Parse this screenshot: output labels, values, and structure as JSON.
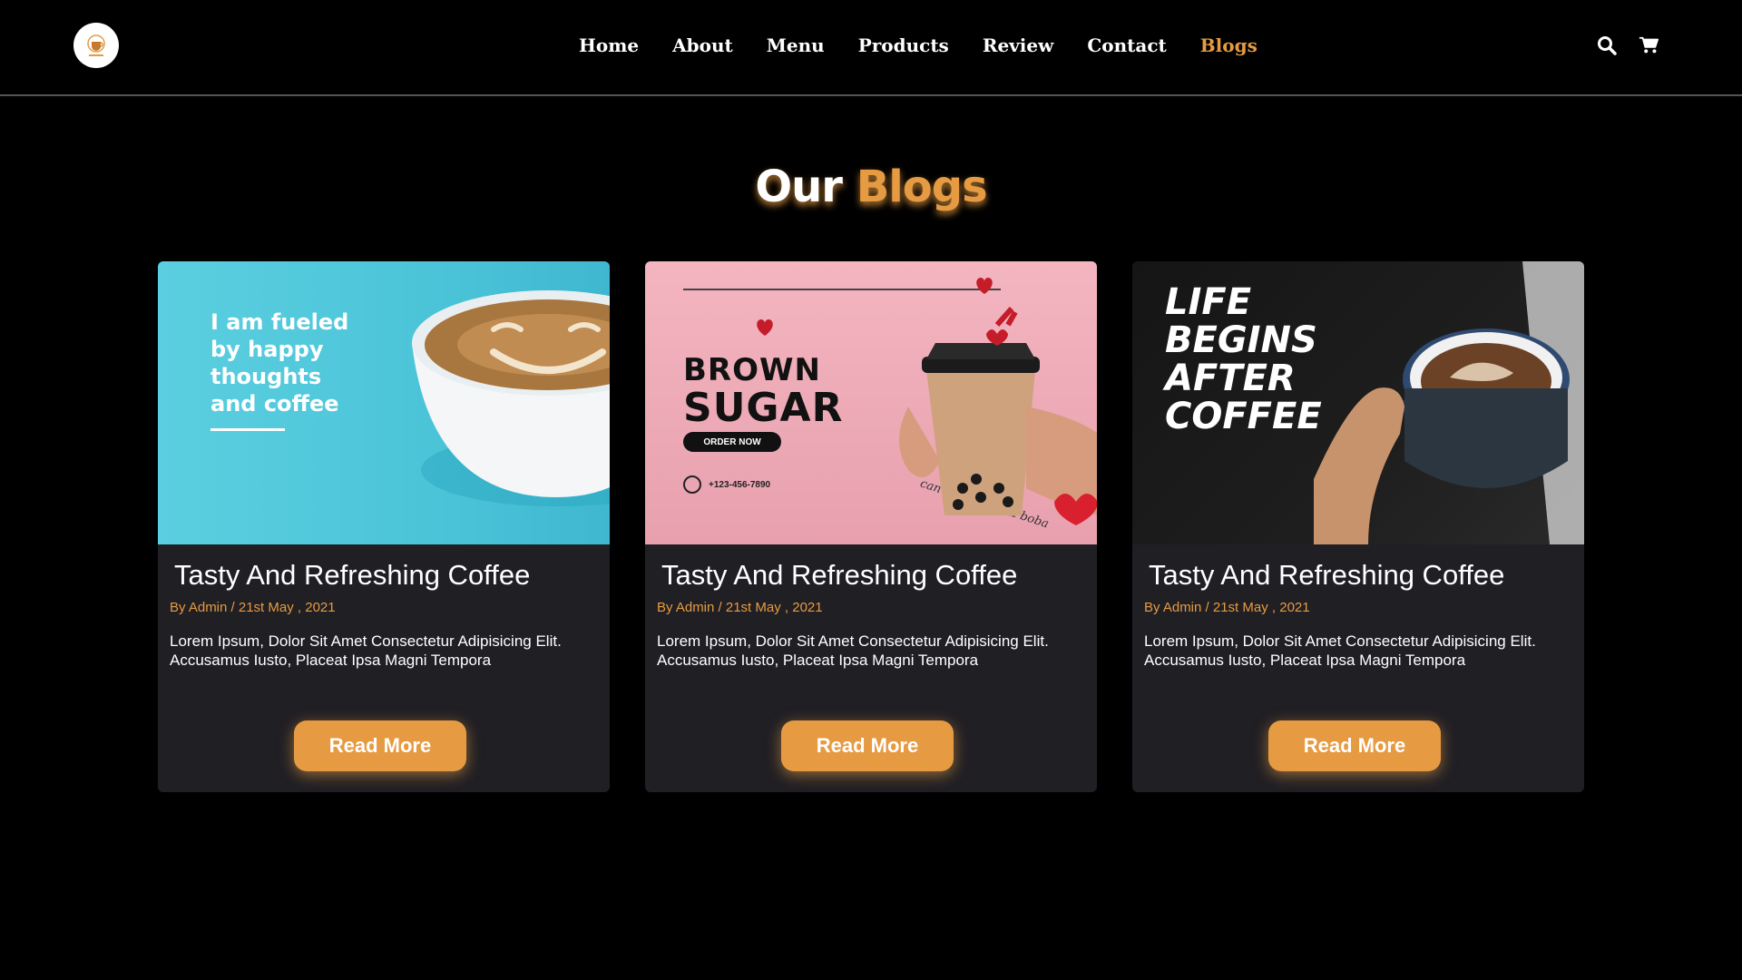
{
  "header": {
    "logo_alt": "coffee-shop-logo",
    "nav": [
      {
        "label": "Home",
        "active": false
      },
      {
        "label": "About",
        "active": false
      },
      {
        "label": "Menu",
        "active": false
      },
      {
        "label": "Products",
        "active": false
      },
      {
        "label": "Review",
        "active": false
      },
      {
        "label": "Contact",
        "active": false
      },
      {
        "label": "Blogs",
        "active": true
      }
    ],
    "icons": [
      "search-icon",
      "cart-icon"
    ]
  },
  "section": {
    "title_part1": "Our",
    "title_part2": "Blogs"
  },
  "colors": {
    "accent": "#e69b42",
    "background": "#000000",
    "card": "#201f24"
  },
  "cards": [
    {
      "image_text": [
        "I am fueled",
        "by happy",
        "thoughts",
        "and coffee"
      ],
      "title": "Tasty And Refreshing Coffee",
      "meta": "By Admin / 21st May , 2021",
      "desc_line1": "Lorem Ipsum, Dolor Sit Amet Consectetur Adipisicing Elit.",
      "desc_line2": "Accusamus Iusto, Placeat Ipsa Magni Tempora",
      "button": "Read More"
    },
    {
      "image_text": [
        "BROWN",
        "SUGAR",
        "ORDER NOW",
        "+123-456-7890",
        "can't life without boba"
      ],
      "title": "Tasty And Refreshing Coffee",
      "meta": "By Admin / 21st May , 2021",
      "desc_line1": "Lorem Ipsum, Dolor Sit Amet Consectetur Adipisicing Elit.",
      "desc_line2": "Accusamus Iusto, Placeat Ipsa Magni Tempora",
      "button": "Read More"
    },
    {
      "image_text": [
        "LIFE",
        "BEGINS",
        "AFTER",
        "COFFEE"
      ],
      "title": "Tasty And Refreshing Coffee",
      "meta": "By Admin / 21st May , 2021",
      "desc_line1": "Lorem Ipsum, Dolor Sit Amet Consectetur Adipisicing Elit.",
      "desc_line2": "Accusamus Iusto, Placeat Ipsa Magni Tempora",
      "button": "Read More"
    }
  ]
}
